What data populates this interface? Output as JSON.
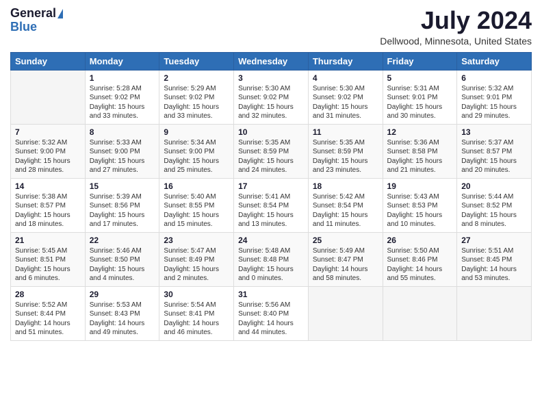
{
  "header": {
    "logo_general": "General",
    "logo_blue": "Blue",
    "month_title": "July 2024",
    "location": "Dellwood, Minnesota, United States"
  },
  "weekdays": [
    "Sunday",
    "Monday",
    "Tuesday",
    "Wednesday",
    "Thursday",
    "Friday",
    "Saturday"
  ],
  "weeks": [
    [
      {
        "day": "",
        "empty": true
      },
      {
        "day": "1",
        "sunrise": "Sunrise: 5:28 AM",
        "sunset": "Sunset: 9:02 PM",
        "daylight": "Daylight: 15 hours and 33 minutes."
      },
      {
        "day": "2",
        "sunrise": "Sunrise: 5:29 AM",
        "sunset": "Sunset: 9:02 PM",
        "daylight": "Daylight: 15 hours and 33 minutes."
      },
      {
        "day": "3",
        "sunrise": "Sunrise: 5:30 AM",
        "sunset": "Sunset: 9:02 PM",
        "daylight": "Daylight: 15 hours and 32 minutes."
      },
      {
        "day": "4",
        "sunrise": "Sunrise: 5:30 AM",
        "sunset": "Sunset: 9:02 PM",
        "daylight": "Daylight: 15 hours and 31 minutes."
      },
      {
        "day": "5",
        "sunrise": "Sunrise: 5:31 AM",
        "sunset": "Sunset: 9:01 PM",
        "daylight": "Daylight: 15 hours and 30 minutes."
      },
      {
        "day": "6",
        "sunrise": "Sunrise: 5:32 AM",
        "sunset": "Sunset: 9:01 PM",
        "daylight": "Daylight: 15 hours and 29 minutes."
      }
    ],
    [
      {
        "day": "7",
        "sunrise": "Sunrise: 5:32 AM",
        "sunset": "Sunset: 9:00 PM",
        "daylight": "Daylight: 15 hours and 28 minutes."
      },
      {
        "day": "8",
        "sunrise": "Sunrise: 5:33 AM",
        "sunset": "Sunset: 9:00 PM",
        "daylight": "Daylight: 15 hours and 27 minutes."
      },
      {
        "day": "9",
        "sunrise": "Sunrise: 5:34 AM",
        "sunset": "Sunset: 9:00 PM",
        "daylight": "Daylight: 15 hours and 25 minutes."
      },
      {
        "day": "10",
        "sunrise": "Sunrise: 5:35 AM",
        "sunset": "Sunset: 8:59 PM",
        "daylight": "Daylight: 15 hours and 24 minutes."
      },
      {
        "day": "11",
        "sunrise": "Sunrise: 5:35 AM",
        "sunset": "Sunset: 8:59 PM",
        "daylight": "Daylight: 15 hours and 23 minutes."
      },
      {
        "day": "12",
        "sunrise": "Sunrise: 5:36 AM",
        "sunset": "Sunset: 8:58 PM",
        "daylight": "Daylight: 15 hours and 21 minutes."
      },
      {
        "day": "13",
        "sunrise": "Sunrise: 5:37 AM",
        "sunset": "Sunset: 8:57 PM",
        "daylight": "Daylight: 15 hours and 20 minutes."
      }
    ],
    [
      {
        "day": "14",
        "sunrise": "Sunrise: 5:38 AM",
        "sunset": "Sunset: 8:57 PM",
        "daylight": "Daylight: 15 hours and 18 minutes."
      },
      {
        "day": "15",
        "sunrise": "Sunrise: 5:39 AM",
        "sunset": "Sunset: 8:56 PM",
        "daylight": "Daylight: 15 hours and 17 minutes."
      },
      {
        "day": "16",
        "sunrise": "Sunrise: 5:40 AM",
        "sunset": "Sunset: 8:55 PM",
        "daylight": "Daylight: 15 hours and 15 minutes."
      },
      {
        "day": "17",
        "sunrise": "Sunrise: 5:41 AM",
        "sunset": "Sunset: 8:54 PM",
        "daylight": "Daylight: 15 hours and 13 minutes."
      },
      {
        "day": "18",
        "sunrise": "Sunrise: 5:42 AM",
        "sunset": "Sunset: 8:54 PM",
        "daylight": "Daylight: 15 hours and 11 minutes."
      },
      {
        "day": "19",
        "sunrise": "Sunrise: 5:43 AM",
        "sunset": "Sunset: 8:53 PM",
        "daylight": "Daylight: 15 hours and 10 minutes."
      },
      {
        "day": "20",
        "sunrise": "Sunrise: 5:44 AM",
        "sunset": "Sunset: 8:52 PM",
        "daylight": "Daylight: 15 hours and 8 minutes."
      }
    ],
    [
      {
        "day": "21",
        "sunrise": "Sunrise: 5:45 AM",
        "sunset": "Sunset: 8:51 PM",
        "daylight": "Daylight: 15 hours and 6 minutes."
      },
      {
        "day": "22",
        "sunrise": "Sunrise: 5:46 AM",
        "sunset": "Sunset: 8:50 PM",
        "daylight": "Daylight: 15 hours and 4 minutes."
      },
      {
        "day": "23",
        "sunrise": "Sunrise: 5:47 AM",
        "sunset": "Sunset: 8:49 PM",
        "daylight": "Daylight: 15 hours and 2 minutes."
      },
      {
        "day": "24",
        "sunrise": "Sunrise: 5:48 AM",
        "sunset": "Sunset: 8:48 PM",
        "daylight": "Daylight: 15 hours and 0 minutes."
      },
      {
        "day": "25",
        "sunrise": "Sunrise: 5:49 AM",
        "sunset": "Sunset: 8:47 PM",
        "daylight": "Daylight: 14 hours and 58 minutes."
      },
      {
        "day": "26",
        "sunrise": "Sunrise: 5:50 AM",
        "sunset": "Sunset: 8:46 PM",
        "daylight": "Daylight: 14 hours and 55 minutes."
      },
      {
        "day": "27",
        "sunrise": "Sunrise: 5:51 AM",
        "sunset": "Sunset: 8:45 PM",
        "daylight": "Daylight: 14 hours and 53 minutes."
      }
    ],
    [
      {
        "day": "28",
        "sunrise": "Sunrise: 5:52 AM",
        "sunset": "Sunset: 8:44 PM",
        "daylight": "Daylight: 14 hours and 51 minutes."
      },
      {
        "day": "29",
        "sunrise": "Sunrise: 5:53 AM",
        "sunset": "Sunset: 8:43 PM",
        "daylight": "Daylight: 14 hours and 49 minutes."
      },
      {
        "day": "30",
        "sunrise": "Sunrise: 5:54 AM",
        "sunset": "Sunset: 8:41 PM",
        "daylight": "Daylight: 14 hours and 46 minutes."
      },
      {
        "day": "31",
        "sunrise": "Sunrise: 5:56 AM",
        "sunset": "Sunset: 8:40 PM",
        "daylight": "Daylight: 14 hours and 44 minutes."
      },
      {
        "day": "",
        "empty": true
      },
      {
        "day": "",
        "empty": true
      },
      {
        "day": "",
        "empty": true
      }
    ]
  ]
}
